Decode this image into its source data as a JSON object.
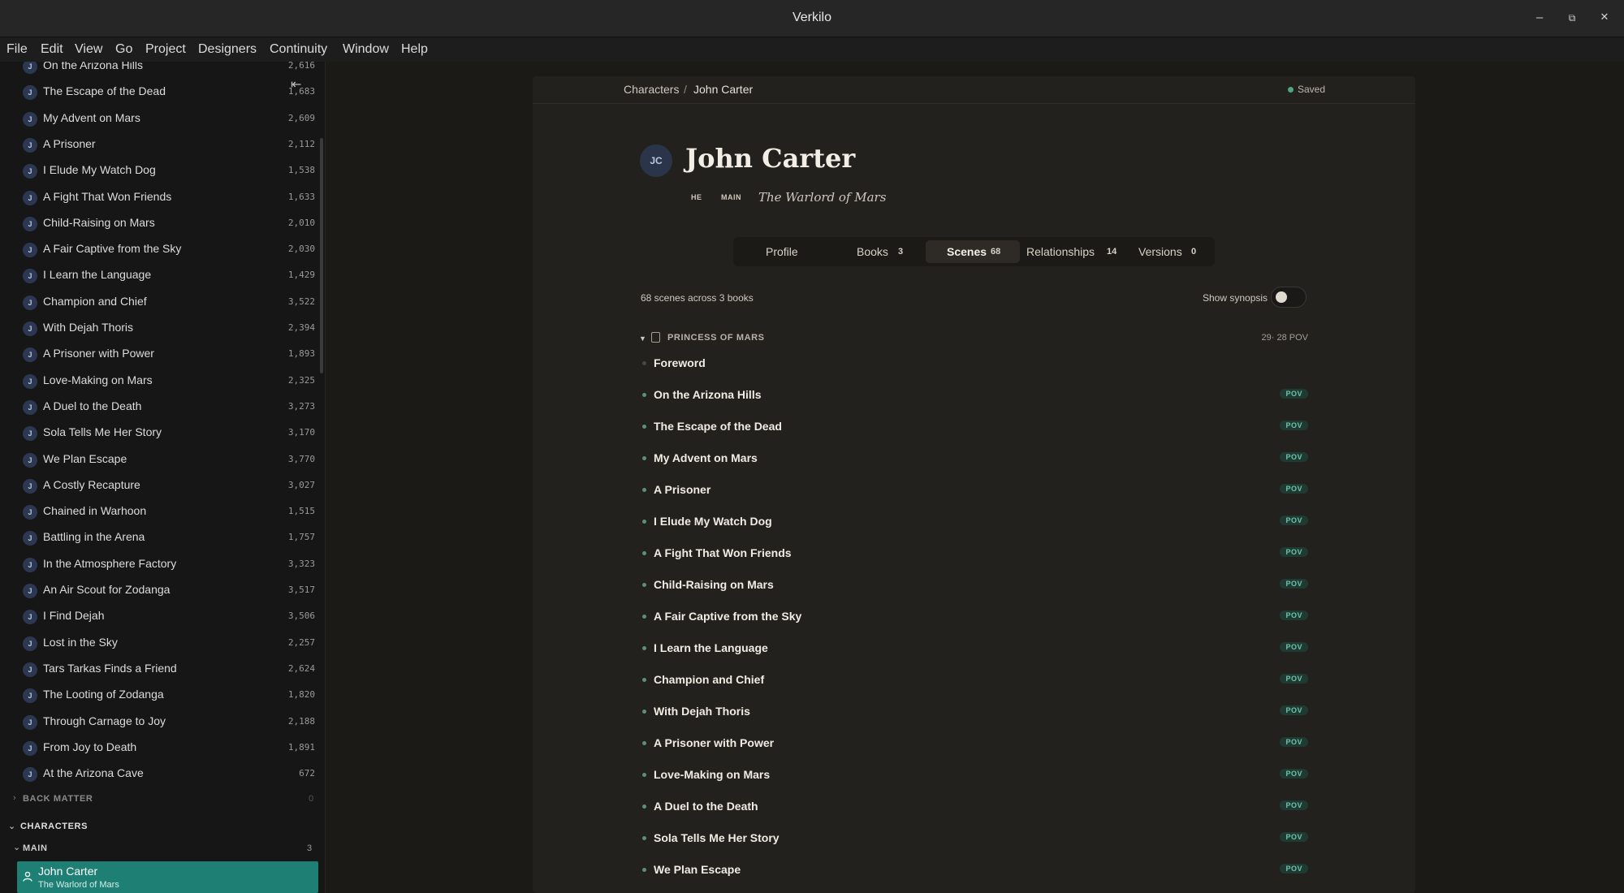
{
  "window": {
    "title": "Verkilo",
    "minimize_label": "–",
    "maximize_label": "⧉",
    "close_label": "✕"
  },
  "menu": [
    "File",
    "Edit",
    "View",
    "Go",
    "Project",
    "Designers",
    "Continuity",
    "Window",
    "Help"
  ],
  "sidebar": {
    "collapse_icon": "⇤",
    "scenes": [
      {
        "badge": "J",
        "title": "On the Arizona Hills",
        "words": "2,616"
      },
      {
        "badge": "J",
        "title": "The Escape of the Dead",
        "words": "1,683"
      },
      {
        "badge": "J",
        "title": "My Advent on Mars",
        "words": "2,609"
      },
      {
        "badge": "J",
        "title": "A Prisoner",
        "words": "2,112"
      },
      {
        "badge": "J",
        "title": "I Elude My Watch Dog",
        "words": "1,538"
      },
      {
        "badge": "J",
        "title": "A Fight That Won Friends",
        "words": "1,633"
      },
      {
        "badge": "J",
        "title": "Child-Raising on Mars",
        "words": "2,010"
      },
      {
        "badge": "J",
        "title": "A Fair Captive from the Sky",
        "words": "2,030"
      },
      {
        "badge": "J",
        "title": "I Learn the Language",
        "words": "1,429"
      },
      {
        "badge": "J",
        "title": "Champion and Chief",
        "words": "3,522"
      },
      {
        "badge": "J",
        "title": "With Dejah Thoris",
        "words": "2,394"
      },
      {
        "badge": "J",
        "title": "A Prisoner with Power",
        "words": "1,893"
      },
      {
        "badge": "J",
        "title": "Love-Making on Mars",
        "words": "2,325"
      },
      {
        "badge": "J",
        "title": "A Duel to the Death",
        "words": "3,273"
      },
      {
        "badge": "J",
        "title": "Sola Tells Me Her Story",
        "words": "3,170"
      },
      {
        "badge": "J",
        "title": "We Plan Escape",
        "words": "3,770"
      },
      {
        "badge": "J",
        "title": "A Costly Recapture",
        "words": "3,027"
      },
      {
        "badge": "J",
        "title": "Chained in Warhoon",
        "words": "1,515"
      },
      {
        "badge": "J",
        "title": "Battling in the Arena",
        "words": "1,757"
      },
      {
        "badge": "J",
        "title": "In the Atmosphere Factory",
        "words": "3,323"
      },
      {
        "badge": "J",
        "title": "An Air Scout for Zodanga",
        "words": "3,517"
      },
      {
        "badge": "J",
        "title": "I Find Dejah",
        "words": "3,506"
      },
      {
        "badge": "J",
        "title": "Lost in the Sky",
        "words": "2,257"
      },
      {
        "badge": "J",
        "title": "Tars Tarkas Finds a Friend",
        "words": "2,624"
      },
      {
        "badge": "J",
        "title": "The Looting of Zodanga",
        "words": "1,820"
      },
      {
        "badge": "J",
        "title": "Through Carnage to Joy",
        "words": "2,188"
      },
      {
        "badge": "J",
        "title": "From Joy to Death",
        "words": "1,891"
      },
      {
        "badge": "J",
        "title": "At the Arizona Cave",
        "words": "672"
      }
    ],
    "back_matter": {
      "label": "BACK MATTER",
      "count": "0"
    },
    "characters": {
      "label": "CHARACTERS"
    },
    "main_group": {
      "label": "MAIN",
      "count": "3"
    },
    "selected_character": {
      "name": "John Carter",
      "subtitle": "The Warlord of Mars"
    }
  },
  "breadcrumb": {
    "parent": "Characters",
    "separator": "/",
    "current": "John Carter"
  },
  "save_status": "Saved",
  "character": {
    "initials": "JC",
    "name": "John Carter",
    "pronoun_tag": "HE",
    "role_tag": "MAIN",
    "book": "The Warlord of Mars"
  },
  "tabs": [
    {
      "label": "Profile",
      "count": ""
    },
    {
      "label": "Books",
      "count": "3"
    },
    {
      "label": "Scenes",
      "count": "68"
    },
    {
      "label": "Relationships",
      "count": "14"
    },
    {
      "label": "Versions",
      "count": "0"
    }
  ],
  "active_tab": "Scenes",
  "scenes_summary": "68 scenes across 3 books",
  "show_synopsis": {
    "label": "Show synopsis",
    "on": false
  },
  "book_group": {
    "title": "PRINCESS OF MARS",
    "count_label": "29· 28 POV",
    "scenes": [
      {
        "title": "Foreword",
        "pov": ""
      },
      {
        "title": "On the Arizona Hills",
        "pov": "POV"
      },
      {
        "title": "The Escape of the Dead",
        "pov": "POV"
      },
      {
        "title": "My Advent on Mars",
        "pov": "POV"
      },
      {
        "title": "A Prisoner",
        "pov": "POV"
      },
      {
        "title": "I Elude My Watch Dog",
        "pov": "POV"
      },
      {
        "title": "A Fight That Won Friends",
        "pov": "POV"
      },
      {
        "title": "Child-Raising on Mars",
        "pov": "POV"
      },
      {
        "title": "A Fair Captive from the Sky",
        "pov": "POV"
      },
      {
        "title": "I Learn the Language",
        "pov": "POV"
      },
      {
        "title": "Champion and Chief",
        "pov": "POV"
      },
      {
        "title": "With Dejah Thoris",
        "pov": "POV"
      },
      {
        "title": "A Prisoner with Power",
        "pov": "POV"
      },
      {
        "title": "Love-Making on Mars",
        "pov": "POV"
      },
      {
        "title": "A Duel to the Death",
        "pov": "POV"
      },
      {
        "title": "Sola Tells Me Her Story",
        "pov": "POV"
      },
      {
        "title": "We Plan Escape",
        "pov": "POV"
      }
    ]
  },
  "colors": {
    "accent": "#1e7f74",
    "saved": "#4fa77a",
    "pov_text": "#6fc2a7",
    "pov_bg": "#1f3a33",
    "avatar": "#2b3549"
  }
}
